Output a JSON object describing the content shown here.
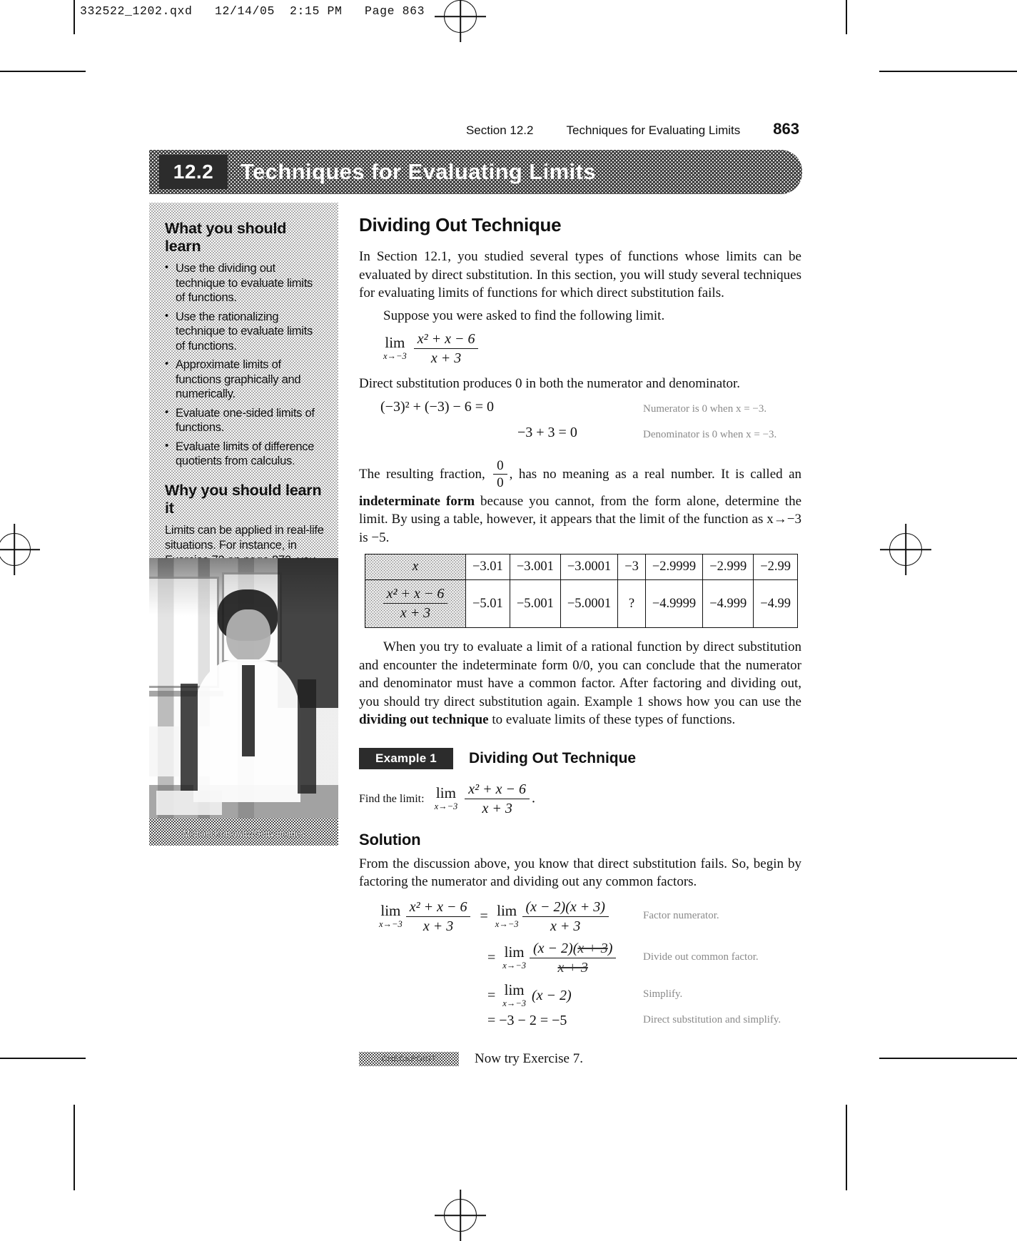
{
  "file_stamp": "332522_1202.qxd   12/14/05  2:15 PM   Page 863",
  "running_head": {
    "section": "Section 12.2",
    "title": "Techniques for Evaluating Limits",
    "page": "863"
  },
  "section_banner": {
    "number": "12.2",
    "title": "Techniques for Evaluating Limits"
  },
  "sidebar": {
    "learn_heading": "What you should learn",
    "learn_items": [
      "Use the dividing out technique to evaluate limits of functions.",
      "Use the rationalizing technique to evaluate limits of functions.",
      "Approximate limits of functions graphically and numerically.",
      "Evaluate one-sided limits of functions.",
      "Evaluate limits of difference quotients from calculus."
    ],
    "why_heading": "Why you should learn it",
    "why_text": "Limits can be applied in real-life situations. For instance, in Exercise 72 on page 872, you will determine limits involving the costs of making photocopies.",
    "photo_credit": "Michael Krasowitz/Getty Images"
  },
  "main": {
    "heading": "Dividing Out Technique",
    "p1": "In Section 12.1, you studied several types of functions whose limits can be evaluated by direct substitution. In this section, you will study several techniques for evaluating limits of functions for which direct substitution fails.",
    "p2": "Suppose you were asked to find the following limit.",
    "limit_display": {
      "lim": "lim",
      "sub": "x→−3",
      "numerator": "x² + x − 6",
      "denominator": "x + 3"
    },
    "p3": "Direct substitution produces 0 in both the numerator and denominator.",
    "substitution": [
      {
        "expr": "(−3)² + (−3) − 6 = 0",
        "note": "Numerator is 0 when x = −3."
      },
      {
        "expr": "−3 + 3 = 0",
        "note": "Denominator is 0 when x = −3."
      }
    ],
    "p4_a": "The resulting fraction, ",
    "p4_frac": "0/0",
    "p4_b": ", has no meaning as a real number. It is called an ",
    "p4_bold": "indeterminate form",
    "p4_c": " because you cannot, from the form alone, determine the limit. By using a table, however, it appears that the limit of the function as x→−3 is −5.",
    "p5": "When you try to evaluate a limit of a rational function by direct substitution and encounter the indeterminate form 0/0, you can conclude that the numerator and denominator must have a common factor. After factoring and dividing out, you should try direct substitution again. Example 1 shows how you can use the ",
    "p5_bold": "dividing out technique",
    "p5_end": " to evaluate limits of these types of functions.",
    "example": {
      "tag": "Example 1",
      "title": "Dividing Out Technique",
      "prompt": "Find the limit:",
      "solution_heading": "Solution",
      "solution_text": "From the discussion above, you know that direct substitution fails. So, begin by factoring the numerator and dividing out any common factors.",
      "steps": [
        {
          "note": "Factor numerator."
        },
        {
          "note": "Divide out common factor."
        },
        {
          "note": "Simplify."
        },
        {
          "note": "Direct substitution and simplify."
        }
      ],
      "step4_result": "= −3 − 2 = −5",
      "checkpoint_tag": "CHECKPOINT",
      "checkpoint_text": "Now try Exercise 7."
    }
  },
  "table": {
    "row1_label": "x",
    "row1": [
      "−3.01",
      "−3.001",
      "−3.0001",
      "−3",
      "−2.9999",
      "−2.999",
      "−2.99"
    ],
    "row2_label_num": "x² + x − 6",
    "row2_label_den": "x + 3",
    "row2": [
      "−5.01",
      "−5.001",
      "−5.0001",
      "?",
      "−4.9999",
      "−4.999",
      "−4.99"
    ]
  },
  "colors": {
    "ink": "#111111",
    "note_gray": "#8a8a8a",
    "banner_dark": "#2c2c2c"
  }
}
